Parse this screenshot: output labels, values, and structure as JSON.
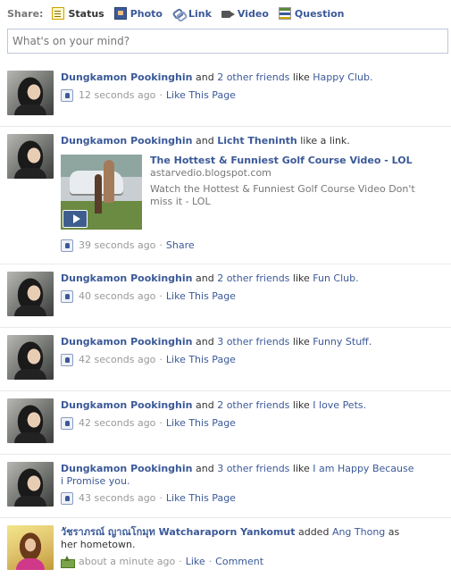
{
  "share": {
    "label": "Share:",
    "options": [
      {
        "label": "Status",
        "icon": "status-icon",
        "active": true
      },
      {
        "label": "Photo",
        "icon": "photo-icon"
      },
      {
        "label": "Link",
        "icon": "link-icon"
      },
      {
        "label": "Video",
        "icon": "video-icon"
      },
      {
        "label": "Question",
        "icon": "question-icon"
      }
    ],
    "placeholder": "What's on your mind?"
  },
  "colors": {
    "link": "#3b5998",
    "meta": "#999999",
    "divider": "#e9e9e9"
  },
  "stories": [
    {
      "actor": "Dungkamon Pookinghin",
      "text_after_actor": " and ",
      "friends_link": "2 other friends",
      "text_mid": " like ",
      "object": "Happy Club.",
      "time": "12 seconds ago",
      "action": "Like This Page",
      "icon": "like-page-icon"
    },
    {
      "actor": "Dungkamon Pookinghin",
      "text_after_actor": " and ",
      "second_actor": "Licht Theninth",
      "text_mid": " like a link.",
      "attachment": {
        "title": "The Hottest & Funniest Golf Course Video - LOL",
        "domain": "astarvedio.blogspot.com",
        "description": "Watch the Hottest & Funniest Golf Course Video Don't miss it - LOL"
      },
      "time": "39 seconds ago",
      "action": "Share",
      "icon": "like-page-icon"
    },
    {
      "actor": "Dungkamon Pookinghin",
      "text_after_actor": " and ",
      "friends_link": "2 other friends",
      "text_mid": " like ",
      "object": "Fun Club.",
      "time": "40 seconds ago",
      "action": "Like This Page",
      "icon": "like-page-icon"
    },
    {
      "actor": "Dungkamon Pookinghin",
      "text_after_actor": " and ",
      "friends_link": "3 other friends",
      "text_mid": " like ",
      "object": "Funny Stuff.",
      "time": "42 seconds ago",
      "action": "Like This Page",
      "icon": "like-page-icon"
    },
    {
      "actor": "Dungkamon Pookinghin",
      "text_after_actor": " and ",
      "friends_link": "2 other friends",
      "text_mid": " like ",
      "object": "I love Pets.",
      "time": "42 seconds ago",
      "action": "Like This Page",
      "icon": "like-page-icon"
    },
    {
      "actor": "Dungkamon Pookinghin",
      "text_after_actor": " and ",
      "friends_link": "3 other friends",
      "text_mid": " like ",
      "object": "I am Happy Because i Promise you.",
      "time": "43 seconds ago",
      "action": "Like This Page",
      "icon": "like-page-icon"
    },
    {
      "actor": "วัชราภรณ์ ญาณโกมุท Watcharaporn Yankomut",
      "text_mid": " added ",
      "object": "Ang Thong",
      "text_after_object": " as her hometown.",
      "time": "about a minute ago",
      "action": "Like",
      "action2": "Comment",
      "icon": "hometown-icon"
    }
  ]
}
